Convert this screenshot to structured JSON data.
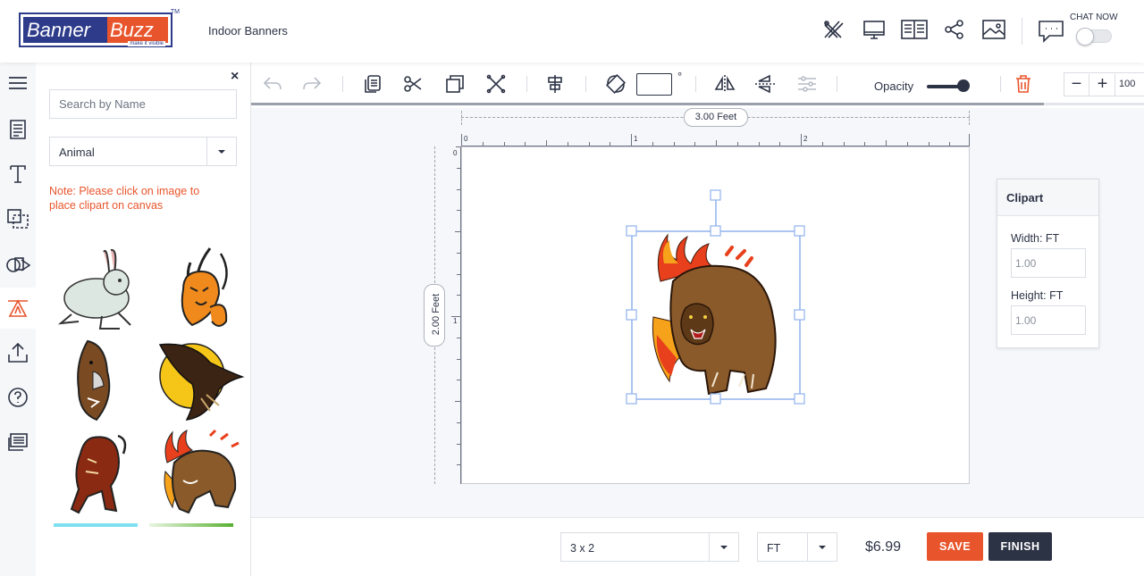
{
  "header": {
    "logo": {
      "part1": "Banner",
      "part2": "Buzz",
      "tagline": "make it visible",
      "tm": "TM"
    },
    "product_title": "Indoor Banners",
    "icons": [
      "design-tools-icon",
      "preview-monitor-icon",
      "guide-book-icon",
      "share-icon",
      "image-gallery-icon",
      "chat-icon"
    ],
    "chat_label": "CHAT NOW",
    "chat_toggle_on": false
  },
  "rail": {
    "items": [
      "menu-icon",
      "template-icon",
      "text-icon",
      "layers-icon",
      "shapes-icon",
      "clipart-icon",
      "upload-icon",
      "help-icon",
      "orders-icon"
    ],
    "active": "clipart-icon"
  },
  "panel": {
    "close": "×",
    "search_placeholder": "Search by Name",
    "category": "Animal",
    "note": "Note: Please click on image to place clipart on canvas",
    "thumbnails": [
      "rabbit",
      "tribal-tiger",
      "bear-head",
      "eagle-moon",
      "lion",
      "fire-bear"
    ]
  },
  "toolbar": {
    "tools": [
      "undo-icon",
      "redo-icon",
      "copy-icon",
      "cut-icon",
      "duplicate-icon",
      "delete-cross-icon",
      "align-icon",
      "rotate-icon",
      "flip-horizontal-icon",
      "flip-vertical-icon",
      "adjust-icon"
    ],
    "rotation_value": "",
    "degree_symbol": "°",
    "opacity_label": "Opacity",
    "opacity_value": 1.0,
    "zoom_value": "100",
    "zoom_minus": "−",
    "zoom_plus": "+"
  },
  "canvas": {
    "width_label": "3.00 Feet",
    "height_label": "2.00 Feet",
    "ruler_top": [
      "0",
      "1",
      "2"
    ],
    "ruler_left": [
      "0",
      "1"
    ],
    "selected_clipart": "fire-bear"
  },
  "clipart_props": {
    "title": "Clipart",
    "width_label": "Width: FT",
    "width_value": "1.00",
    "height_label": "Height: FT",
    "height_value": "1.00"
  },
  "bottom": {
    "size_option": "3 x 2",
    "unit_option": "FT",
    "price": "$6.99",
    "save_label": "SAVE",
    "finish_label": "FINISH"
  },
  "colors": {
    "accent": "#e8552c",
    "dark": "#2c3345",
    "brand_blue": "#2d3b8a",
    "selection": "#8fb2ec"
  }
}
